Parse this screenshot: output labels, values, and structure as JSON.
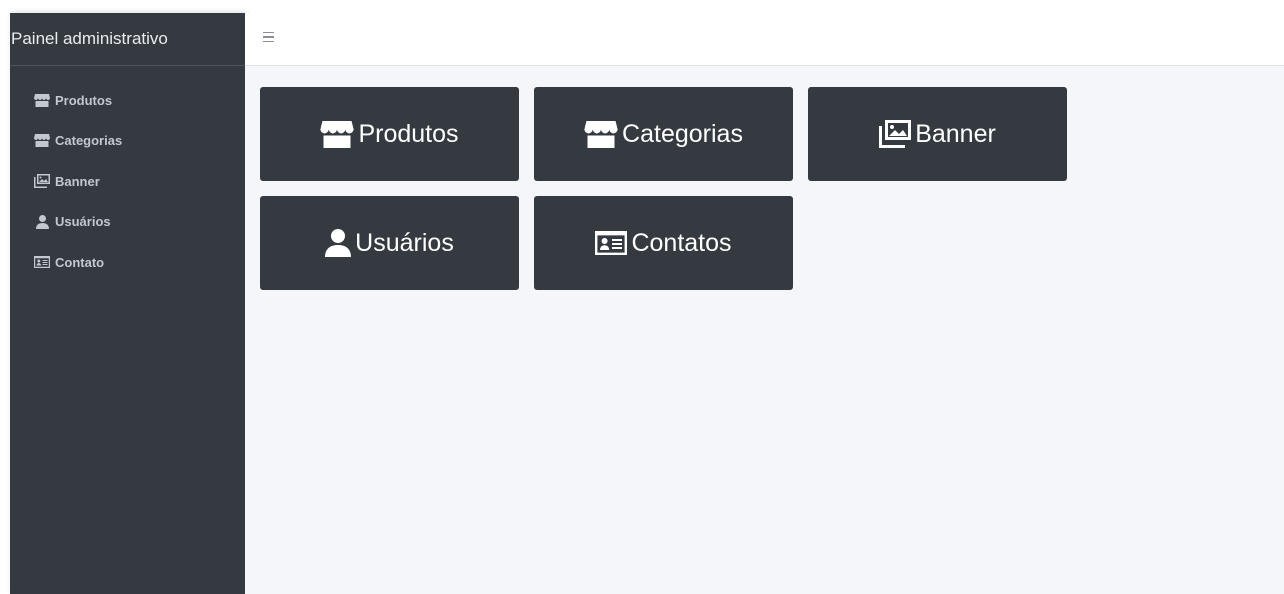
{
  "sidebar": {
    "brand": "Painel administrativo",
    "items": [
      {
        "label": "Produtos",
        "icon": "store-icon"
      },
      {
        "label": "Categorias",
        "icon": "store-icon"
      },
      {
        "label": "Banner",
        "icon": "images-icon"
      },
      {
        "label": "Usuários",
        "icon": "user-icon"
      },
      {
        "label": "Contato",
        "icon": "id-card-icon"
      }
    ]
  },
  "topbar": {
    "menu_icon": "hamburger-icon"
  },
  "tiles": [
    {
      "label": "Produtos",
      "icon": "store-icon"
    },
    {
      "label": "Categorias",
      "icon": "store-icon"
    },
    {
      "label": "Banner",
      "icon": "images-icon"
    },
    {
      "label": "Usuários",
      "icon": "user-icon"
    },
    {
      "label": "Contatos",
      "icon": "id-card-icon"
    }
  ],
  "colors": {
    "sidebar_bg": "#343a40",
    "tile_bg": "#343a40",
    "content_bg": "#f4f6f9",
    "sidebar_text": "#c2c7d0"
  }
}
